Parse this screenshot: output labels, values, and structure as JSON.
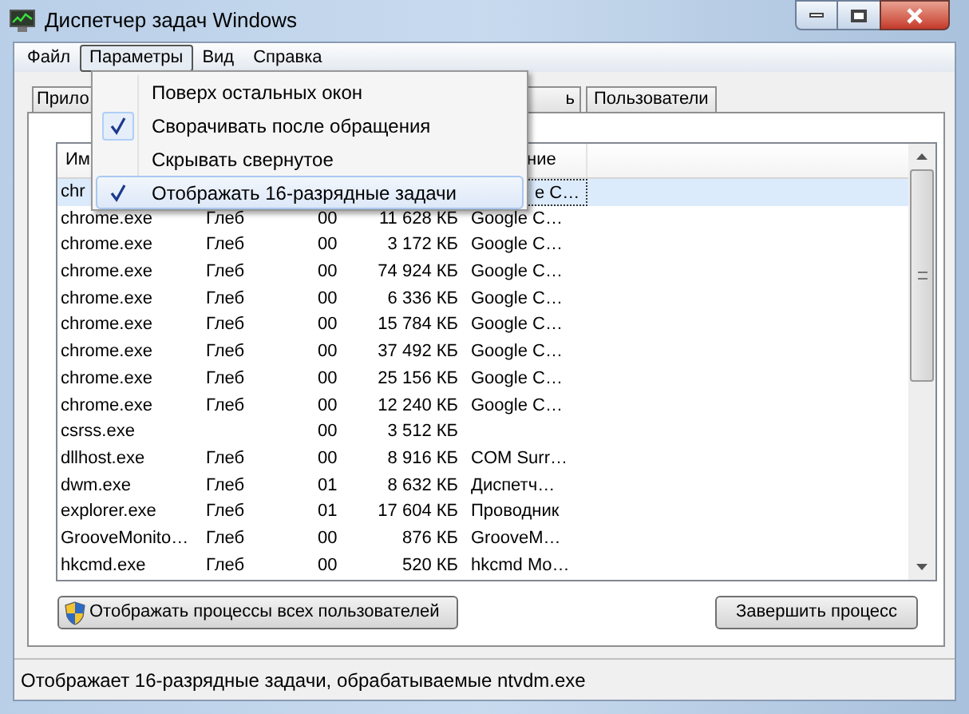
{
  "window": {
    "title": "Диспетчер задач Windows"
  },
  "menu_bar": [
    {
      "label": "Файл",
      "selected": false
    },
    {
      "label": "Параметры",
      "selected": true
    },
    {
      "label": "Вид",
      "selected": false
    },
    {
      "label": "Справка",
      "selected": false
    }
  ],
  "dropdown": [
    {
      "label": "Поверх остальных окон",
      "checked": false,
      "highlighted": false
    },
    {
      "label": "Сворачивать после обращения",
      "checked": true,
      "highlighted": false
    },
    {
      "label": "Скрывать свернутое",
      "checked": false,
      "highlighted": false
    },
    {
      "label": "Отображать 16-разрядные задачи",
      "checked": true,
      "highlighted": true
    }
  ],
  "tabs": [
    {
      "label": "Прило",
      "selected": false
    },
    {
      "label": "ь",
      "selected": false
    },
    {
      "label": "Пользователи",
      "selected": false
    }
  ],
  "table": {
    "columns": [
      "Им",
      "",
      "",
      "",
      "ние"
    ],
    "rows": [
      {
        "cells": [
          "chr",
          "",
          "",
          "",
          "e C…"
        ],
        "selected": true
      },
      {
        "cells": [
          "chrome.exe",
          "Глеб",
          "00",
          "11 628 КБ",
          "Google C…"
        ],
        "selected": false
      },
      {
        "cells": [
          "chrome.exe",
          "Глеб",
          "00",
          "3 172 КБ",
          "Google C…"
        ],
        "selected": false
      },
      {
        "cells": [
          "chrome.exe",
          "Глеб",
          "00",
          "74 924 КБ",
          "Google C…"
        ],
        "selected": false
      },
      {
        "cells": [
          "chrome.exe",
          "Глеб",
          "00",
          "6 336 КБ",
          "Google C…"
        ],
        "selected": false
      },
      {
        "cells": [
          "chrome.exe",
          "Глеб",
          "00",
          "15 784 КБ",
          "Google C…"
        ],
        "selected": false
      },
      {
        "cells": [
          "chrome.exe",
          "Глеб",
          "00",
          "37 492 КБ",
          "Google C…"
        ],
        "selected": false
      },
      {
        "cells": [
          "chrome.exe",
          "Глеб",
          "00",
          "25 156 КБ",
          "Google C…"
        ],
        "selected": false
      },
      {
        "cells": [
          "chrome.exe",
          "Глеб",
          "00",
          "12 240 КБ",
          "Google C…"
        ],
        "selected": false
      },
      {
        "cells": [
          "csrss.exe",
          "",
          "00",
          "3 512 КБ",
          ""
        ],
        "selected": false
      },
      {
        "cells": [
          "dllhost.exe",
          "Глеб",
          "00",
          "8 916 КБ",
          "COM Surr…"
        ],
        "selected": false
      },
      {
        "cells": [
          "dwm.exe",
          "Глеб",
          "01",
          "8 632 КБ",
          "Диспетч…"
        ],
        "selected": false
      },
      {
        "cells": [
          "explorer.exe",
          "Глеб",
          "01",
          "17 604 КБ",
          "Проводник"
        ],
        "selected": false
      },
      {
        "cells": [
          "GrooveMonito…",
          "Глеб",
          "00",
          "876 КБ",
          "GrooveM…"
        ],
        "selected": false
      },
      {
        "cells": [
          "hkcmd.exe",
          "Глеб",
          "00",
          "520 КБ",
          "hkcmd Mo…"
        ],
        "selected": false
      }
    ]
  },
  "buttons": {
    "show_all": "Отображать процессы всех пользователей",
    "end_process": "Завершить процесс"
  },
  "status_bar": "Отображает 16-разрядные задачи, обрабатываемые ntvdm.exe"
}
